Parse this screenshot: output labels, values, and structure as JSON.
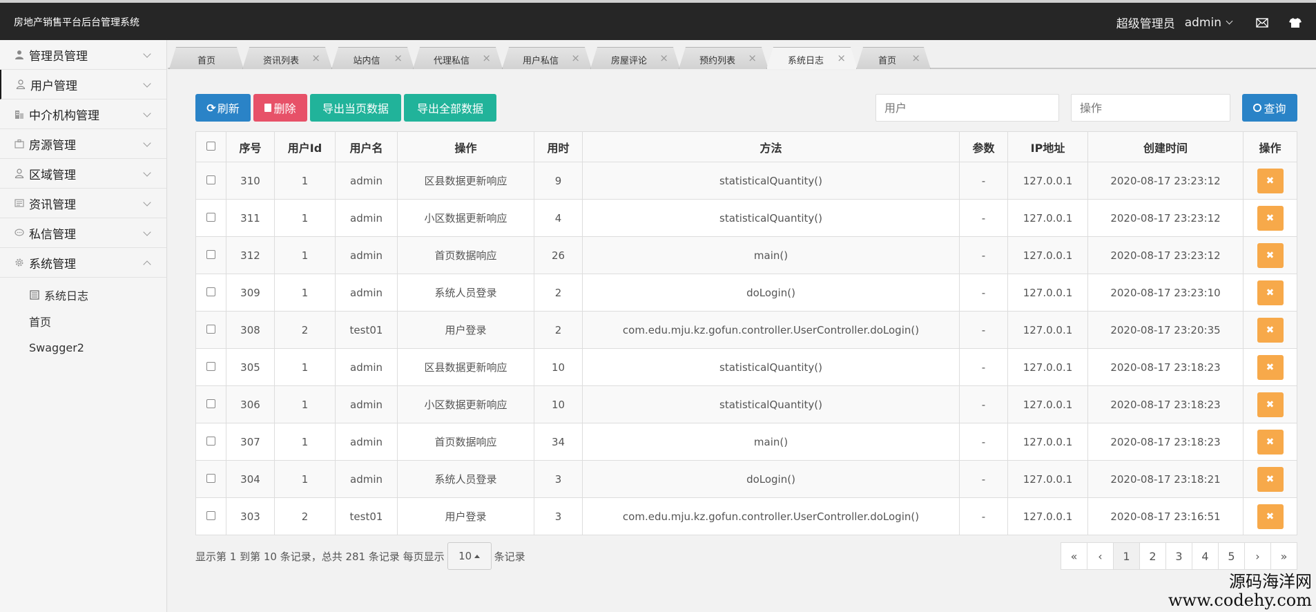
{
  "header": {
    "app_title": "房地产销售平台后台管理系统",
    "role": "超级管理员",
    "username": "admin"
  },
  "sidebar": {
    "items": [
      {
        "label": "管理员管理",
        "icon": "user-icon"
      },
      {
        "label": "用户管理",
        "icon": "user-outline-icon"
      },
      {
        "label": "中介机构管理",
        "icon": "building-icon"
      },
      {
        "label": "房源管理",
        "icon": "house-icon"
      },
      {
        "label": "区域管理",
        "icon": "user-outline-icon"
      },
      {
        "label": "资讯管理",
        "icon": "news-icon"
      },
      {
        "label": "私信管理",
        "icon": "chat-icon"
      },
      {
        "label": "系统管理",
        "icon": "gear-icon"
      }
    ],
    "subitems": [
      {
        "label": "系统日志"
      },
      {
        "label": "首页"
      },
      {
        "label": "Swagger2"
      }
    ]
  },
  "tabs": [
    {
      "label": "首页"
    },
    {
      "label": "资讯列表"
    },
    {
      "label": "站内信"
    },
    {
      "label": "代理私信"
    },
    {
      "label": "用户私信"
    },
    {
      "label": "房屋评论"
    },
    {
      "label": "预约列表"
    },
    {
      "label": "系统日志"
    },
    {
      "label": "首页"
    }
  ],
  "toolbar": {
    "refresh": "刷新",
    "delete": "删除",
    "export_page": "导出当页数据",
    "export_all": "导出全部数据",
    "user_placeholder": "用户",
    "op_placeholder": "操作",
    "query": "查询"
  },
  "table": {
    "headers": [
      "序号",
      "用户Id",
      "用户名",
      "操作",
      "用时",
      "方法",
      "参数",
      "IP地址",
      "创建时间",
      "操作"
    ],
    "rows": [
      [
        "310",
        "1",
        "admin",
        "区县数据更新响应",
        "9",
        "statisticalQuantity()",
        "-",
        "127.0.0.1",
        "2020-08-17 23:23:12"
      ],
      [
        "311",
        "1",
        "admin",
        "小区数据更新响应",
        "4",
        "statisticalQuantity()",
        "-",
        "127.0.0.1",
        "2020-08-17 23:23:12"
      ],
      [
        "312",
        "1",
        "admin",
        "首页数据响应",
        "26",
        "main()",
        "-",
        "127.0.0.1",
        "2020-08-17 23:23:12"
      ],
      [
        "309",
        "1",
        "admin",
        "系统人员登录",
        "2",
        "doLogin()",
        "-",
        "127.0.0.1",
        "2020-08-17 23:23:10"
      ],
      [
        "308",
        "2",
        "test01",
        "用户登录",
        "2",
        "com.edu.mju.kz.gofun.controller.UserController.doLogin()",
        "-",
        "127.0.0.1",
        "2020-08-17 23:20:35"
      ],
      [
        "305",
        "1",
        "admin",
        "区县数据更新响应",
        "10",
        "statisticalQuantity()",
        "-",
        "127.0.0.1",
        "2020-08-17 23:18:23"
      ],
      [
        "306",
        "1",
        "admin",
        "小区数据更新响应",
        "10",
        "statisticalQuantity()",
        "-",
        "127.0.0.1",
        "2020-08-17 23:18:23"
      ],
      [
        "307",
        "1",
        "admin",
        "首页数据响应",
        "34",
        "main()",
        "-",
        "127.0.0.1",
        "2020-08-17 23:18:23"
      ],
      [
        "304",
        "1",
        "admin",
        "系统人员登录",
        "3",
        "doLogin()",
        "-",
        "127.0.0.1",
        "2020-08-17 23:18:21"
      ],
      [
        "303",
        "2",
        "test01",
        "用户登录",
        "3",
        "com.edu.mju.kz.gofun.controller.UserController.doLogin()",
        "-",
        "127.0.0.1",
        "2020-08-17 23:16:51"
      ]
    ]
  },
  "footer": {
    "info_prefix": "显示第 1 到第 10 条记录，总共 281 条记录 每页显示",
    "page_size": "10",
    "info_suffix": "条记录",
    "pages": [
      "«",
      "‹",
      "1",
      "2",
      "3",
      "4",
      "5",
      "›",
      "»"
    ],
    "current_page": "1"
  },
  "watermark": {
    "line1": "源码海洋网",
    "line2": "www.codehy.com"
  }
}
